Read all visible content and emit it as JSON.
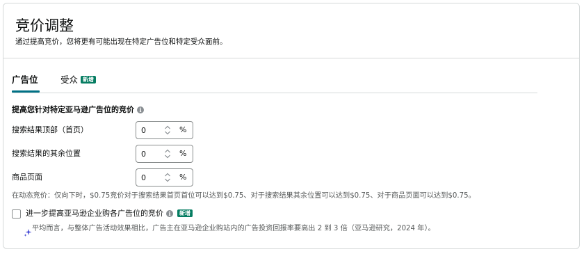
{
  "header": {
    "title": "竞价调整",
    "subtitle": "通过提高竞价，您将更有可能出现在特定广告位和特定受众面前。"
  },
  "tabs": [
    {
      "label": "广告位",
      "active": true
    },
    {
      "label": "受众",
      "active": false,
      "badge": "新增"
    }
  ],
  "placement": {
    "heading": "提高您针对特定亚马逊广告位的竞价",
    "heading_icon": "info-icon",
    "rows": [
      {
        "label": "搜索结果顶部（首页）",
        "value": "0",
        "unit": "%"
      },
      {
        "label": "搜索结果的其余位置",
        "value": "0",
        "unit": "%"
      },
      {
        "label": "商品页面",
        "value": "0",
        "unit": "%"
      }
    ],
    "dynamic_note": "在动态竞价：仅向下时，$0.75竞价对于搜索结果首页首位可以达到$0.75、对于搜索结果其余位置可以达到$0.75、对于商品页面可以达到$0.75。"
  },
  "business": {
    "checkbox_label": "进一步提高亚马逊企业购各广告位的竞价",
    "checked": false,
    "badge": "新增",
    "insight_icon": "sparkle-icon",
    "insight": "平均而言，与整体广告活动效果相比，广告主在亚马逊企业购站内的广告投资回报率要高出 2 到 3 倍（亚马逊研究，2024 年）。"
  },
  "colors": {
    "accent_tab": "#007185",
    "badge_bg": "#067d62",
    "border": "#d5d9d9",
    "muted_text": "#565959"
  }
}
